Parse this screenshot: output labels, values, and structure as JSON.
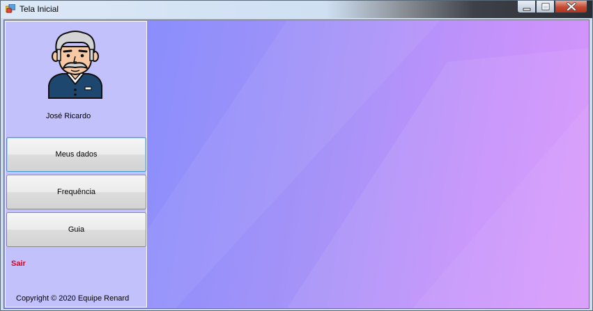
{
  "window": {
    "title": "Tela Inicial",
    "icons": {
      "app": "app-windows-form-icon",
      "minimize": "minimize-icon",
      "maximize": "maximize-icon",
      "close": "close-icon"
    }
  },
  "sidebar": {
    "avatar_icon": "elderly-man-avatar-icon",
    "user_name": "José Ricardo",
    "buttons": [
      {
        "label": "Meus dados"
      },
      {
        "label": "Frequência"
      },
      {
        "label": "Guia"
      }
    ],
    "exit_label": "Sair",
    "copyright": "Copyright © 2020 Equipe Renard"
  },
  "colors": {
    "sidebar_bg": "#c3c1fc",
    "main_gradient_start": "#8a8efc",
    "main_gradient_end": "#d795fb",
    "exit_link": "#e0001b",
    "focus_border": "#3c9ad6"
  }
}
